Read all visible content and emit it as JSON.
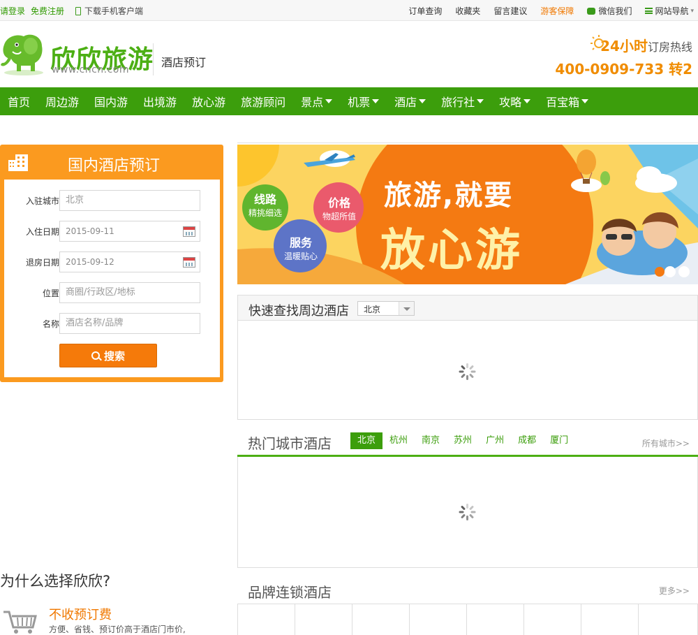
{
  "topbar": {
    "login": "请登录",
    "register": "免费注册",
    "app_download": "下载手机客户端",
    "links": [
      "订单查询",
      "收藏夹",
      "留言建议"
    ],
    "guarantee": "游客保障",
    "wechat": "微信我们",
    "sitemap": "网站导航"
  },
  "header": {
    "logo_text": "欣欣旅游",
    "logo_url": "www.cncn.com",
    "subtitle": "酒店预订",
    "hotline_24": "24小时",
    "hotline_label": "订房热线",
    "hotline_number": "400-0909-733 转2"
  },
  "nav": {
    "items": [
      {
        "label": "首页",
        "dropdown": false
      },
      {
        "label": "周边游",
        "dropdown": false
      },
      {
        "label": "国内游",
        "dropdown": false
      },
      {
        "label": "出境游",
        "dropdown": false
      },
      {
        "label": "放心游",
        "dropdown": false
      },
      {
        "label": "旅游顾问",
        "dropdown": false
      },
      {
        "label": "景点",
        "dropdown": true
      },
      {
        "label": "机票",
        "dropdown": true
      },
      {
        "label": "酒店",
        "dropdown": true
      },
      {
        "label": "旅行社",
        "dropdown": true
      },
      {
        "label": "攻略",
        "dropdown": true
      },
      {
        "label": "百宝箱",
        "dropdown": true
      }
    ]
  },
  "booking": {
    "title": "国内酒店预订",
    "city_label": "入驻城市",
    "city_value": "北京",
    "checkin_label": "入住日期",
    "checkin_value": "2015-09-11",
    "checkout_label": "退房日期",
    "checkout_value": "2015-09-12",
    "location_label": "位置",
    "location_placeholder": "商圈/行政区/地标",
    "name_label": "名称",
    "name_placeholder": "酒店名称/品牌",
    "search_label": "搜索"
  },
  "banner": {
    "bubble1_title": "线路",
    "bubble1_sub": "精挑细选",
    "bubble2_title": "价格",
    "bubble2_sub": "物超所值",
    "bubble3_title": "服务",
    "bubble3_sub": "温暖贴心",
    "slogan1": "旅游,就要",
    "slogan2": "放心游"
  },
  "nearby": {
    "title": "快速查找周边酒店",
    "city": "北京"
  },
  "hot": {
    "title": "热门城市酒店",
    "tabs": [
      "北京",
      "杭州",
      "南京",
      "苏州",
      "广州",
      "成都",
      "厦门"
    ],
    "active": "北京",
    "more": "所有城市>>"
  },
  "why": {
    "title": "为什么选择欣欣?",
    "item_title": "不收预订费",
    "item_desc": "方便、省钱、预订价高于酒店门市价,"
  },
  "brand": {
    "title": "品牌连锁酒店",
    "more": "更多>>"
  },
  "colors": {
    "nav_green": "#3c9e0c",
    "booking_orange": "#fb9a1f",
    "accent_orange": "#f07800"
  }
}
